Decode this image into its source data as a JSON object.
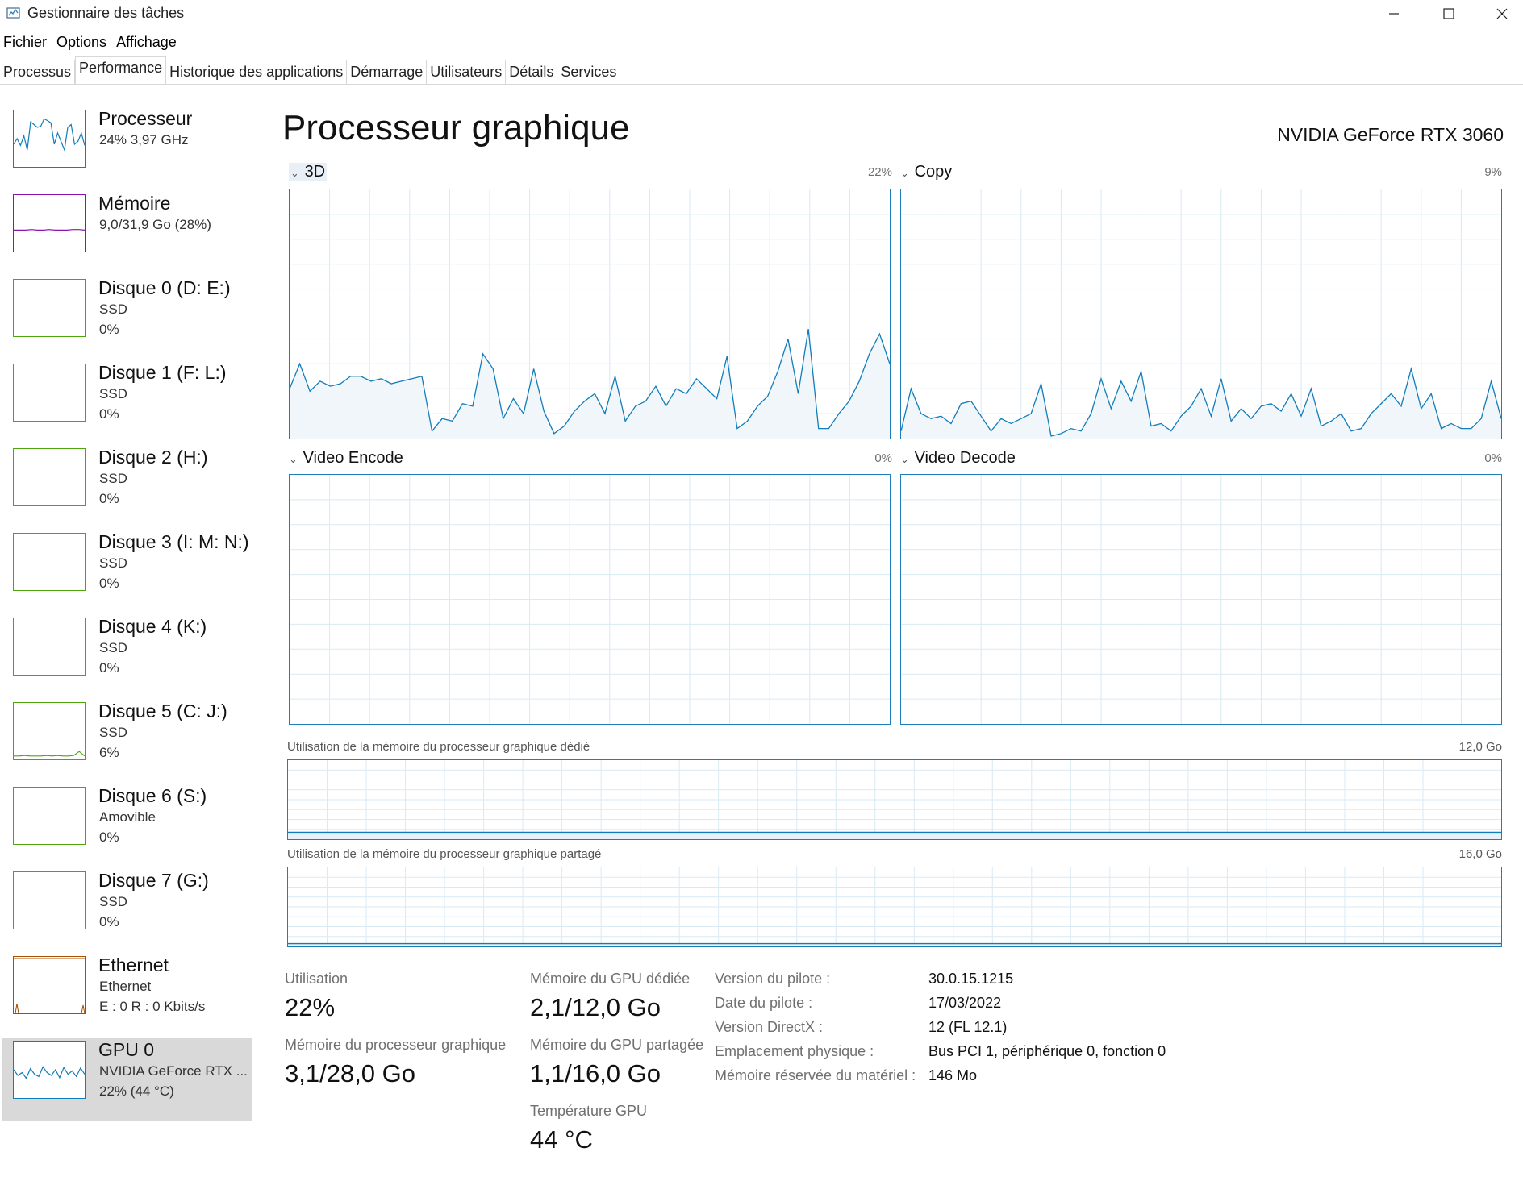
{
  "window": {
    "title": "Gestionnaire des tâches"
  },
  "menu": [
    "Fichier",
    "Options",
    "Affichage"
  ],
  "tabs": [
    {
      "label": "Processus",
      "active": false
    },
    {
      "label": "Performance",
      "active": true
    },
    {
      "label": "Historique des applications",
      "active": false
    },
    {
      "label": "Démarrage",
      "active": false
    },
    {
      "label": "Utilisateurs",
      "active": false
    },
    {
      "label": "Détails",
      "active": false
    },
    {
      "label": "Services",
      "active": false
    }
  ],
  "sidebar": [
    {
      "name": "Processeur",
      "sub1": "24%  3,97 GHz",
      "sub2": "",
      "color": "#117dbb",
      "selected": false
    },
    {
      "name": "Mémoire",
      "sub1": "9,0/31,9 Go (28%)",
      "sub2": "",
      "color": "#8b12ae",
      "selected": false
    },
    {
      "name": "Disque 0 (D: E:)",
      "sub1": "SSD",
      "sub2": "0%",
      "color": "#4da60c",
      "selected": false
    },
    {
      "name": "Disque 1 (F: L:)",
      "sub1": "SSD",
      "sub2": "0%",
      "color": "#4da60c",
      "selected": false
    },
    {
      "name": "Disque 2 (H:)",
      "sub1": "SSD",
      "sub2": "0%",
      "color": "#4da60c",
      "selected": false
    },
    {
      "name": "Disque 3 (I: M: N:)",
      "sub1": "SSD",
      "sub2": "0%",
      "color": "#4da60c",
      "selected": false
    },
    {
      "name": "Disque 4 (K:)",
      "sub1": "SSD",
      "sub2": "0%",
      "color": "#4da60c",
      "selected": false
    },
    {
      "name": "Disque 5 (C: J:)",
      "sub1": "SSD",
      "sub2": "6%",
      "color": "#4da60c",
      "selected": false
    },
    {
      "name": "Disque 6 (S:)",
      "sub1": "Amovible",
      "sub2": "0%",
      "color": "#4da60c",
      "selected": false
    },
    {
      "name": "Disque 7 (G:)",
      "sub1": "SSD",
      "sub2": "0%",
      "color": "#4da60c",
      "selected": false
    },
    {
      "name": "Ethernet",
      "sub1": "Ethernet",
      "sub2": "E : 0  R : 0 Kbits/s",
      "color": "#a74f01",
      "selected": false
    },
    {
      "name": "GPU 0",
      "sub1": "NVIDIA GeForce RTX ...",
      "sub2": "22%  (44 °C)",
      "color": "#117dbb",
      "selected": true
    }
  ],
  "main": {
    "title": "Processeur graphique",
    "gpu_name": "NVIDIA GeForce RTX 3060",
    "graphs": [
      {
        "label": "3D",
        "pct": "22%",
        "values": [
          20,
          30,
          19,
          23,
          21,
          22,
          25,
          25,
          23,
          24,
          22,
          23,
          24,
          25,
          3,
          8,
          7,
          14,
          13,
          34,
          28,
          8,
          16,
          10,
          28,
          11,
          2,
          5,
          11,
          15,
          18,
          10,
          25,
          7,
          13,
          15,
          21,
          13,
          20,
          18,
          24,
          20,
          16,
          33,
          4,
          7,
          13,
          17,
          27,
          40,
          18,
          44,
          4,
          4,
          10,
          15,
          23,
          34,
          42,
          30
        ],
        "series_color": "#117dbb"
      },
      {
        "label": "Copy",
        "pct": "9%",
        "values": [
          3,
          20,
          10,
          8,
          9,
          6,
          14,
          15,
          9,
          3,
          8,
          6,
          8,
          10,
          22,
          1,
          2,
          4,
          3,
          10,
          24,
          12,
          23,
          15,
          27,
          5,
          6,
          3,
          9,
          13,
          20,
          9,
          24,
          7,
          12,
          8,
          13,
          14,
          11,
          18,
          9,
          20,
          5,
          7,
          10,
          3,
          4,
          10,
          14,
          18,
          13,
          28,
          12,
          18,
          4,
          6,
          4,
          4,
          8,
          23,
          8
        ]
      },
      {
        "label": "Video Encode",
        "pct": "0%",
        "values": []
      },
      {
        "label": "Video Decode",
        "pct": "0%",
        "values": []
      }
    ],
    "mem_dedicated": {
      "label": "Utilisation de la mémoire du processeur graphique dédié",
      "max": "12,0 Go",
      "fraction": 0.175
    },
    "mem_shared": {
      "label": "Utilisation de la mémoire du processeur graphique partagé",
      "max": "16,0 Go",
      "fraction": 0.07
    },
    "stats": {
      "utilisation_label": "Utilisation",
      "utilisation_value": "22%",
      "gpu_mem_label": "Mémoire du processeur graphique",
      "gpu_mem_value": "3,1/28,0 Go",
      "dedicated_label": "Mémoire du GPU dédiée",
      "dedicated_value": "2,1/12,0 Go",
      "shared_label": "Mémoire du GPU partagée",
      "shared_value": "1,1/16,0 Go",
      "temp_label": "Température GPU",
      "temp_value": "44 °C"
    },
    "info": [
      {
        "label": "Version du pilote :",
        "value": "30.0.15.1215"
      },
      {
        "label": "Date du pilote :",
        "value": "17/03/2022"
      },
      {
        "label": "Version DirectX :",
        "value": "12 (FL 12.1)"
      },
      {
        "label": "Emplacement physique :",
        "value": "Bus PCI 1, périphérique 0, fonction 0"
      },
      {
        "label": "Mémoire réservée du matériel :",
        "value": "146 Mo"
      }
    ]
  }
}
